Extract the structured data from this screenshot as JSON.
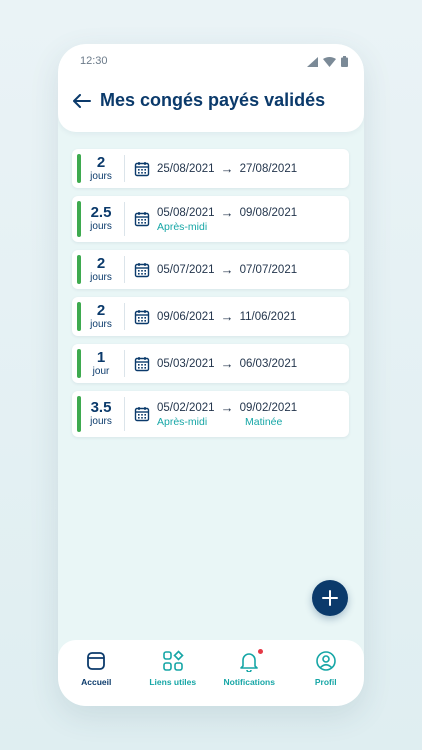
{
  "status_bar": {
    "time": "12:30",
    "icons": [
      "signal-icon",
      "wifi-icon",
      "battery-icon"
    ]
  },
  "header": {
    "title": "Mes congés payés validés",
    "back_icon": "arrow-left-icon"
  },
  "leaves": [
    {
      "count": "2",
      "unit": "jours",
      "start": "25/08/2021",
      "end": "27/08/2021",
      "start_note": "",
      "end_note": ""
    },
    {
      "count": "2.5",
      "unit": "jours",
      "start": "05/08/2021",
      "end": "09/08/2021",
      "start_note": "Après-midi",
      "end_note": ""
    },
    {
      "count": "2",
      "unit": "jours",
      "start": "05/07/2021",
      "end": "07/07/2021",
      "start_note": "",
      "end_note": ""
    },
    {
      "count": "2",
      "unit": "jours",
      "start": "09/06/2021",
      "end": "11/06/2021",
      "start_note": "",
      "end_note": ""
    },
    {
      "count": "1",
      "unit": "jour",
      "start": "05/03/2021",
      "end": "06/03/2021",
      "start_note": "",
      "end_note": ""
    },
    {
      "count": "3.5",
      "unit": "jours",
      "start": "05/02/2021",
      "end": "09/02/2021",
      "start_note": "Après-midi",
      "end_note": "Matinée"
    }
  ],
  "arrow_glyph": "→",
  "fab": {
    "icon": "plus-icon"
  },
  "nav": {
    "items": [
      {
        "label": "Accueil",
        "icon": "home-icon"
      },
      {
        "label": "Liens utiles",
        "icon": "grid-icon"
      },
      {
        "label": "Notifications",
        "icon": "bell-icon"
      },
      {
        "label": "Profil",
        "icon": "profile-icon"
      }
    ]
  },
  "colors": {
    "primary": "#0b3a6b",
    "accent": "#16a6a6",
    "status_bar_green": "#3eaa4f",
    "notification_dot": "#e53946"
  }
}
